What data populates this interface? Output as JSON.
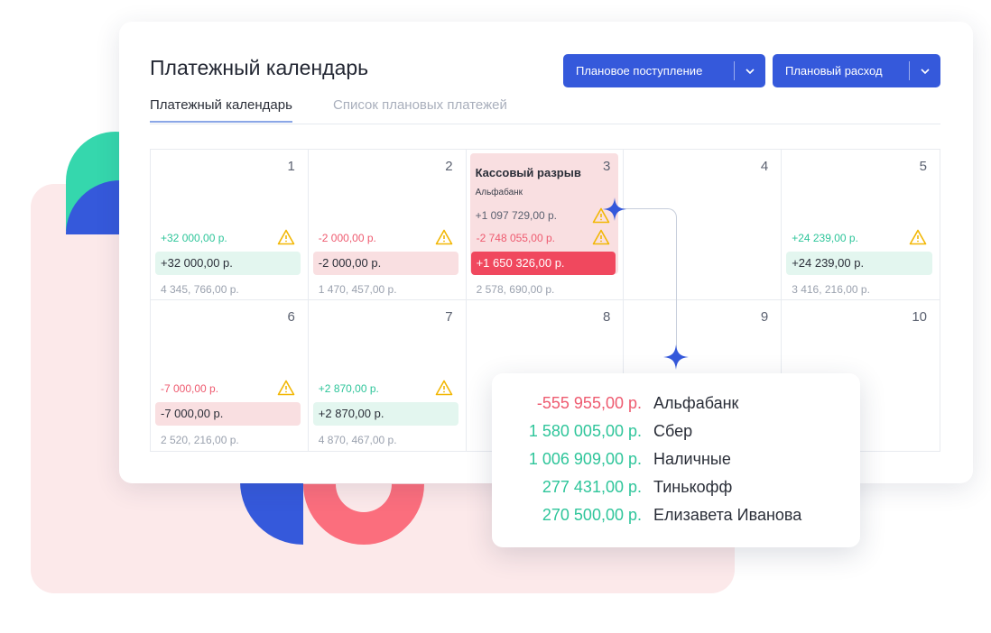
{
  "colors": {
    "accent": "#3559db",
    "positive": "#2ec59a",
    "negative": "#ee5a6f",
    "gap": "#f0485e",
    "warning": "#f2b705"
  },
  "header": {
    "title": "Платежный календарь",
    "income_button": "Плановое поступление",
    "expense_button": "Плановый расход"
  },
  "tabs": [
    {
      "label": "Платежный календарь",
      "active": true
    },
    {
      "label": "Список плановых платежей",
      "active": false
    }
  ],
  "calendar": {
    "days": [
      {
        "day": "1",
        "delta": "+32 000,00 р.",
        "pill": "+32 000,00 р.",
        "balance": "4 345, 766,00 р."
      },
      {
        "day": "2",
        "delta": "-2 000,00 р.",
        "pill": "-2 000,00 р.",
        "balance": "1 470, 457,00 р."
      },
      {
        "day": "3",
        "gap_title": "Кассовый разрыв",
        "gap_bank": "Альфабанк",
        "income": "+1 097 729,00 р.",
        "delta": "-2 748 055,00 р.",
        "pill": "+1 650 326,00 р.",
        "balance": "2 578, 690,00 р."
      },
      {
        "day": "4"
      },
      {
        "day": "5",
        "delta": "+24 239,00 р.",
        "pill": "+24 239,00 р.",
        "balance": "3 416, 216,00 р."
      },
      {
        "day": "6",
        "delta": "-7 000,00 р.",
        "pill": "-7 000,00 р.",
        "balance": "2 520, 216,00 р."
      },
      {
        "day": "7",
        "delta": "+2 870,00 р.",
        "pill": "+2 870,00 р.",
        "balance": "4 870, 467,00 р."
      },
      {
        "day": "8"
      },
      {
        "day": "9"
      },
      {
        "day": "10"
      }
    ]
  },
  "tooltip": {
    "rows": [
      {
        "amount": "-555 955,00 р.",
        "name": "Альфабанк"
      },
      {
        "amount": "1 580 005,00 р.",
        "name": "Сбер"
      },
      {
        "amount": "1 006 909,00 р.",
        "name": "Наличные"
      },
      {
        "amount": "277 431,00 р.",
        "name": "Тинькофф"
      },
      {
        "amount": "270 500,00 р.",
        "name": "Елизавета Иванова"
      }
    ]
  }
}
